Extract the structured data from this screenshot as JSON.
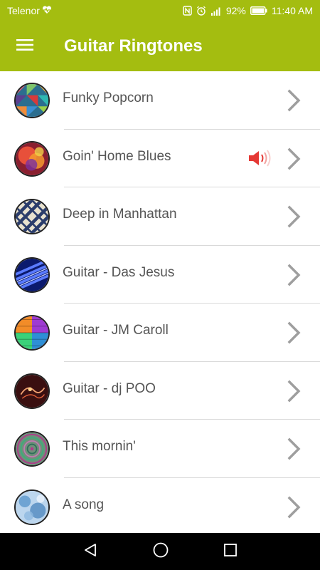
{
  "status": {
    "carrier": "Telenor",
    "battery": "92%",
    "time": "11:40 AM"
  },
  "header": {
    "title": "Guitar Ringtones"
  },
  "ringtones": [
    {
      "title": "Funky Popcorn"
    },
    {
      "title": "Goin' Home Blues",
      "playing": true
    },
    {
      "title": "Deep in Manhattan"
    },
    {
      "title": "Guitar - Das Jesus"
    },
    {
      "title": "Guitar - JM Caroll"
    },
    {
      "title": "Guitar - dj POO"
    },
    {
      "title": "This mornin'"
    },
    {
      "title": "A song"
    }
  ],
  "colors": {
    "accent": "#a4bd10",
    "playing_icon": "#e53935"
  },
  "icons": {
    "menu": "hamburger-icon",
    "row_action": "chevron-right-icon",
    "playing": "speaker-volume-icon"
  }
}
